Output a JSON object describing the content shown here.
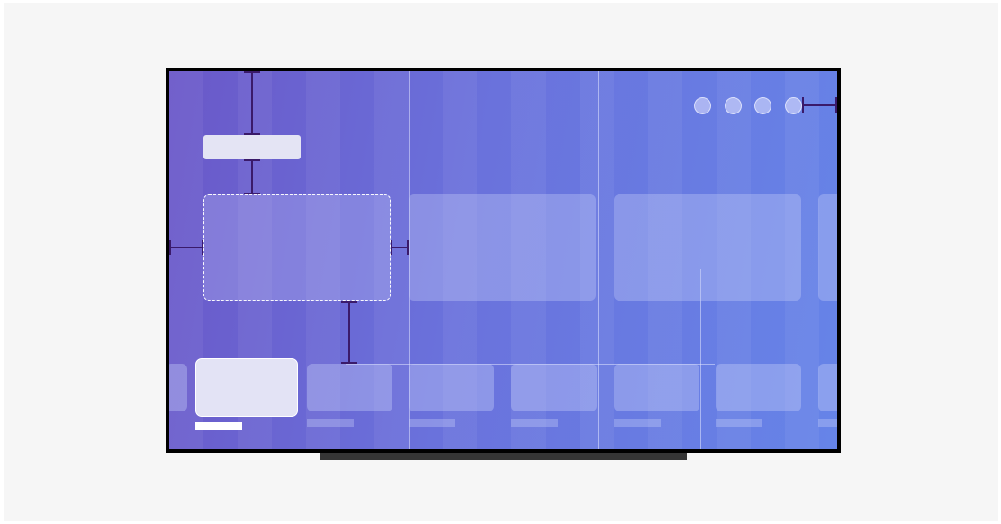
{
  "colors": {
    "page_background": "#f6f6f6",
    "tv_bezel": "#000000",
    "tv_stand": "#353535",
    "screen_gradient_start": "#6a58c8",
    "screen_gradient_end": "#6684e8",
    "measurement_marker": "#3a1a6a",
    "selected_item": "#e3e3f5"
  },
  "icons": [
    "page-dot-icon",
    "page-dot-icon",
    "page-dot-icon",
    "page-dot-icon"
  ],
  "content_rows": {
    "top_row_cards": 4,
    "bottom_row_thumbnails": 8,
    "focused_card_index": 0,
    "selected_thumbnail_index": 1
  }
}
